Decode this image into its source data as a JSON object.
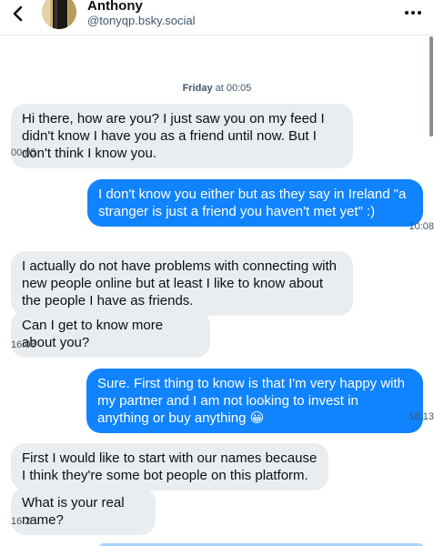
{
  "header": {
    "name": "Anthony",
    "handle": "@tonyqp.bsky.social",
    "back_icon": "chevron-left-icon",
    "more_icon": "more-horizontal-icon"
  },
  "date_separator": {
    "day": "Friday",
    "rest": " at 00:05"
  },
  "messages": [
    {
      "from": "them",
      "text": "Hi there, how are you? I just saw you on my feed I didn't know I have you as a friend until now. But I don't think I know you."
    },
    {
      "from": "them_time",
      "text": "00:05"
    },
    {
      "from": "me",
      "text": "I don't know you either but as they say in Ireland \"a stranger is just a friend you haven't met yet\" :)"
    },
    {
      "from": "me_time",
      "text": "10:08"
    },
    {
      "from": "them",
      "text": "I actually do not have problems with connecting with new people online but at least I like to know about the people I have as friends."
    },
    {
      "from": "them",
      "text": "Can I get to know more about you?"
    },
    {
      "from": "them_time",
      "text": "16:08"
    },
    {
      "from": "me",
      "text": "Sure. First thing to know is that I'm very happy with my partner and I am not looking to invest in anything or buy anything 😀"
    },
    {
      "from": "me_time",
      "text": "16:13"
    },
    {
      "from": "them",
      "text": "First I would like to start with our names because I think they're some bot people on this platform."
    },
    {
      "from": "them",
      "text": "What is your real name?"
    },
    {
      "from": "them_time",
      "text": "16:25"
    }
  ],
  "colors": {
    "outgoing_bubble": "#1083fe",
    "incoming_bubble": "#eaedf0",
    "secondary_text": "#42576c"
  }
}
